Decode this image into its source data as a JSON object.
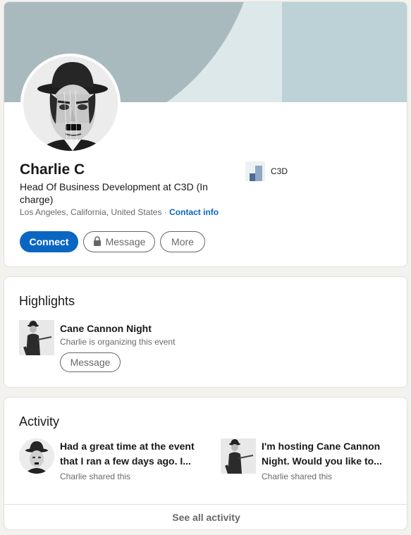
{
  "profile": {
    "name": "Charlie C",
    "headline": "Head Of Business Development at C3D (In charge)",
    "location": "Los Angeles, California, United States",
    "separator": " · ",
    "contact_info": "Contact info",
    "company": "C3D",
    "actions": {
      "connect": "Connect",
      "message": "Message",
      "more": "More"
    }
  },
  "highlights": {
    "title": "Highlights",
    "event_title": "Cane Cannon Night",
    "event_subtitle": "Charlie is organizing this event",
    "message_label": "Message"
  },
  "activity": {
    "title": "Activity",
    "items": [
      {
        "text": "Had a great time at the event that I ran a few days ago. I...",
        "meta": "Charlie shared this"
      },
      {
        "text": "I'm hosting Cane Cannon Night. Would you like to...",
        "meta": "Charlie shared this"
      }
    ],
    "see_all": "See all activity"
  },
  "colors": {
    "accent": "#0a66c2",
    "banner_dark": "#a9babf",
    "banner_light": "#dde8ea"
  }
}
